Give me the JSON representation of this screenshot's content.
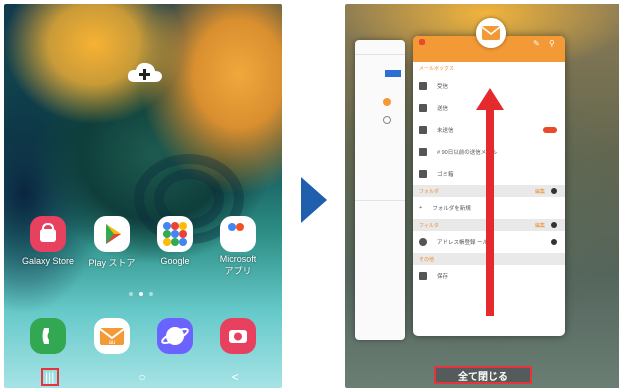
{
  "left_screen": {
    "home_apps": [
      {
        "label": "Galaxy Store",
        "icon": "galaxy-store-icon",
        "color": "#e8415f"
      },
      {
        "label": "Play ストア",
        "icon": "play-store-icon",
        "color": "#ffffff"
      },
      {
        "label": "Google",
        "icon": "google-folder-icon",
        "color": "#ffffff"
      },
      {
        "label": "Microsoft\nアプリ",
        "icon": "microsoft-folder-icon",
        "color": "#ffffff"
      }
    ],
    "dock_apps": [
      {
        "icon": "phone-icon",
        "color": "#33a853"
      },
      {
        "icon": "au-mail-icon",
        "color": "#ffffff"
      },
      {
        "icon": "internet-browser-icon",
        "color": "#6b63ff"
      },
      {
        "icon": "camera-icon",
        "color": "#e8415f"
      }
    ],
    "nav": {
      "recent": "|||",
      "home": "○",
      "back": "<"
    }
  },
  "right_screen": {
    "card": {
      "section_title": "メールボックス",
      "rows": [
        {
          "label": "受信",
          "icon": "inbox-icon"
        },
        {
          "label": "送信",
          "icon": "sent-icon"
        },
        {
          "label": "未送信",
          "icon": "draft-icon"
        },
        {
          "label": "# 90日以前の送信メール",
          "icon": "archive-icon"
        },
        {
          "label": "ゴミ箱",
          "icon": "trash-icon"
        }
      ],
      "folder_band": "フォルダ",
      "folder_edit": "編集",
      "add_folder": "フォルダを新規",
      "filter_band": "フィルタ",
      "filter_edit": "編集",
      "filter_row": "アドレス帳登録 ール",
      "other_band": "その他",
      "other_row": "保存"
    },
    "close_all_label": "全て閉じる"
  }
}
